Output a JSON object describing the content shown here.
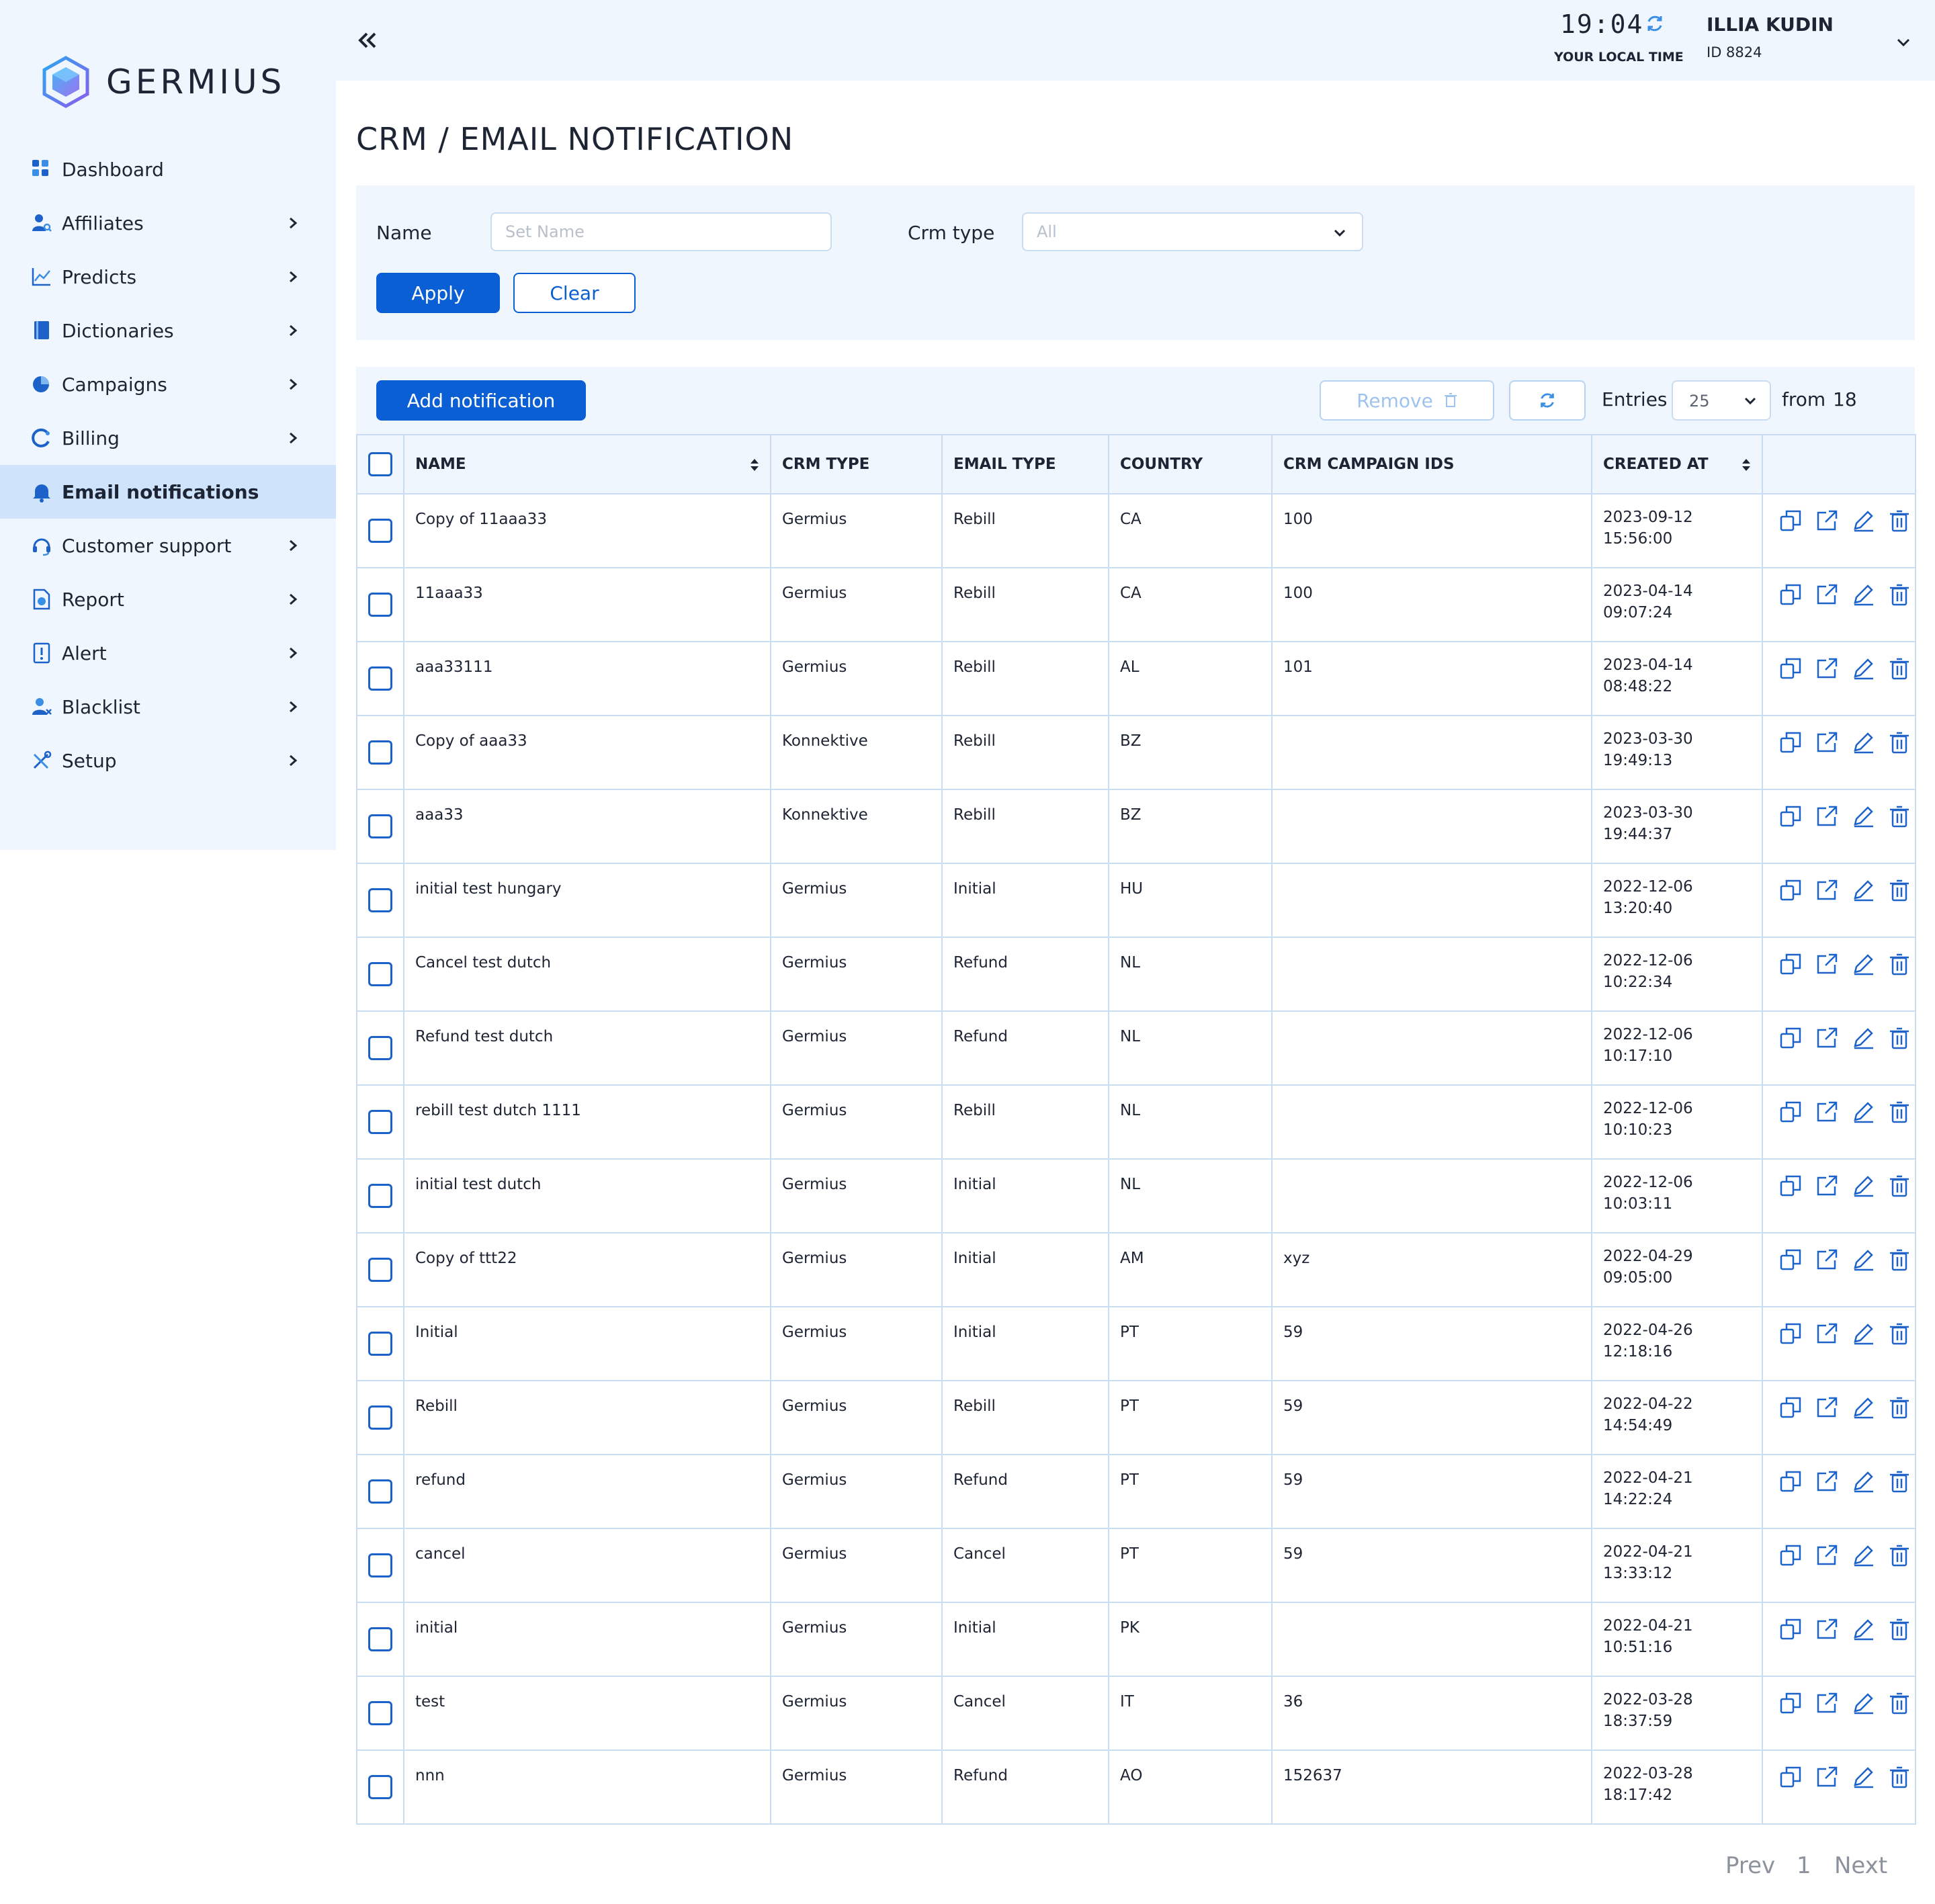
{
  "brand": {
    "name": "GERMIUS"
  },
  "sidebar": {
    "items": [
      {
        "label": "Dashboard",
        "icon": "dashboard-icon",
        "has_submenu": false,
        "active": false
      },
      {
        "label": "Affiliates",
        "icon": "affiliates-icon",
        "has_submenu": true,
        "active": false
      },
      {
        "label": "Predicts",
        "icon": "predicts-icon",
        "has_submenu": true,
        "active": false
      },
      {
        "label": "Dictionaries",
        "icon": "dictionaries-icon",
        "has_submenu": true,
        "active": false
      },
      {
        "label": "Campaigns",
        "icon": "campaigns-icon",
        "has_submenu": true,
        "active": false
      },
      {
        "label": "Billing",
        "icon": "billing-icon",
        "has_submenu": true,
        "active": false
      },
      {
        "label": "Email notifications",
        "icon": "bell-icon",
        "has_submenu": false,
        "active": true
      },
      {
        "label": "Customer support",
        "icon": "headset-icon",
        "has_submenu": true,
        "active": false
      },
      {
        "label": "Report",
        "icon": "report-icon",
        "has_submenu": true,
        "active": false
      },
      {
        "label": "Alert",
        "icon": "alert-icon",
        "has_submenu": true,
        "active": false
      },
      {
        "label": "Blacklist",
        "icon": "blacklist-icon",
        "has_submenu": true,
        "active": false
      },
      {
        "label": "Setup",
        "icon": "setup-icon",
        "has_submenu": true,
        "active": false
      }
    ]
  },
  "header": {
    "time": "19:04",
    "time_label": "YOUR LOCAL TIME",
    "user_name": "ILLIA KUDIN",
    "user_id": "ID 8824"
  },
  "page": {
    "title": "CRM / EMAIL NOTIFICATION"
  },
  "filters": {
    "name_label": "Name",
    "name_placeholder": "Set Name",
    "name_value": "",
    "crm_type_label": "Crm type",
    "crm_type_value": "All",
    "apply_label": "Apply",
    "clear_label": "Clear"
  },
  "toolbar": {
    "add_label": "Add notification",
    "remove_label": "Remove",
    "entries_label": "Entries",
    "entries_value": "25",
    "from_label": "from",
    "total": "18"
  },
  "table": {
    "columns": [
      "NAME",
      "CRM TYPE",
      "EMAIL TYPE",
      "COUNTRY",
      "CRM CAMPAIGN IDS",
      "CREATED AT"
    ],
    "rows": [
      {
        "name": "Copy of 11aaa33",
        "crm_type": "Germius",
        "email_type": "Rebill",
        "country": "CA",
        "campaign_ids": "100",
        "date": "2023-09-12",
        "time": "15:56:00"
      },
      {
        "name": "11aaa33",
        "crm_type": "Germius",
        "email_type": "Rebill",
        "country": "CA",
        "campaign_ids": "100",
        "date": "2023-04-14",
        "time": "09:07:24"
      },
      {
        "name": "aaa33111",
        "crm_type": "Germius",
        "email_type": "Rebill",
        "country": "AL",
        "campaign_ids": "101",
        "date": "2023-04-14",
        "time": "08:48:22"
      },
      {
        "name": "Copy of aaa33",
        "crm_type": "Konnektive",
        "email_type": "Rebill",
        "country": "BZ",
        "campaign_ids": "",
        "date": "2023-03-30",
        "time": "19:49:13"
      },
      {
        "name": "aaa33",
        "crm_type": "Konnektive",
        "email_type": "Rebill",
        "country": "BZ",
        "campaign_ids": "",
        "date": "2023-03-30",
        "time": "19:44:37"
      },
      {
        "name": "initial test hungary",
        "crm_type": "Germius",
        "email_type": "Initial",
        "country": "HU",
        "campaign_ids": "",
        "date": "2022-12-06",
        "time": "13:20:40"
      },
      {
        "name": "Cancel test dutch",
        "crm_type": "Germius",
        "email_type": "Refund",
        "country": "NL",
        "campaign_ids": "",
        "date": "2022-12-06",
        "time": "10:22:34"
      },
      {
        "name": "Refund test dutch",
        "crm_type": "Germius",
        "email_type": "Refund",
        "country": "NL",
        "campaign_ids": "",
        "date": "2022-12-06",
        "time": "10:17:10"
      },
      {
        "name": "rebill test dutch 1111",
        "crm_type": "Germius",
        "email_type": "Rebill",
        "country": "NL",
        "campaign_ids": "",
        "date": "2022-12-06",
        "time": "10:10:23"
      },
      {
        "name": "initial test dutch",
        "crm_type": "Germius",
        "email_type": "Initial",
        "country": "NL",
        "campaign_ids": "",
        "date": "2022-12-06",
        "time": "10:03:11"
      },
      {
        "name": "Copy of ttt22",
        "crm_type": "Germius",
        "email_type": "Initial",
        "country": "AM",
        "campaign_ids": "xyz",
        "date": "2022-04-29",
        "time": "09:05:00"
      },
      {
        "name": "Initial",
        "crm_type": "Germius",
        "email_type": "Initial",
        "country": "PT",
        "campaign_ids": "59",
        "date": "2022-04-26",
        "time": "12:18:16"
      },
      {
        "name": "Rebill",
        "crm_type": "Germius",
        "email_type": "Rebill",
        "country": "PT",
        "campaign_ids": "59",
        "date": "2022-04-22",
        "time": "14:54:49"
      },
      {
        "name": "refund",
        "crm_type": "Germius",
        "email_type": "Refund",
        "country": "PT",
        "campaign_ids": "59",
        "date": "2022-04-21",
        "time": "14:22:24"
      },
      {
        "name": "cancel",
        "crm_type": "Germius",
        "email_type": "Cancel",
        "country": "PT",
        "campaign_ids": "59",
        "date": "2022-04-21",
        "time": "13:33:12"
      },
      {
        "name": "initial",
        "crm_type": "Germius",
        "email_type": "Initial",
        "country": "PK",
        "campaign_ids": "",
        "date": "2022-04-21",
        "time": "10:51:16"
      },
      {
        "name": "test",
        "crm_type": "Germius",
        "email_type": "Cancel",
        "country": "IT",
        "campaign_ids": "36",
        "date": "2022-03-28",
        "time": "18:37:59"
      },
      {
        "name": "nnn",
        "crm_type": "Germius",
        "email_type": "Refund",
        "country": "AO",
        "campaign_ids": "152637",
        "date": "2022-03-28",
        "time": "18:17:42"
      }
    ]
  },
  "pagination": {
    "prev": "Prev",
    "page": "1",
    "next": "Next"
  },
  "colors": {
    "accent": "#0a5fd4",
    "sidebar_bg": "#f0f6fd",
    "active_item_bg": "#cfe4fb",
    "border": "#c9dcf1"
  }
}
